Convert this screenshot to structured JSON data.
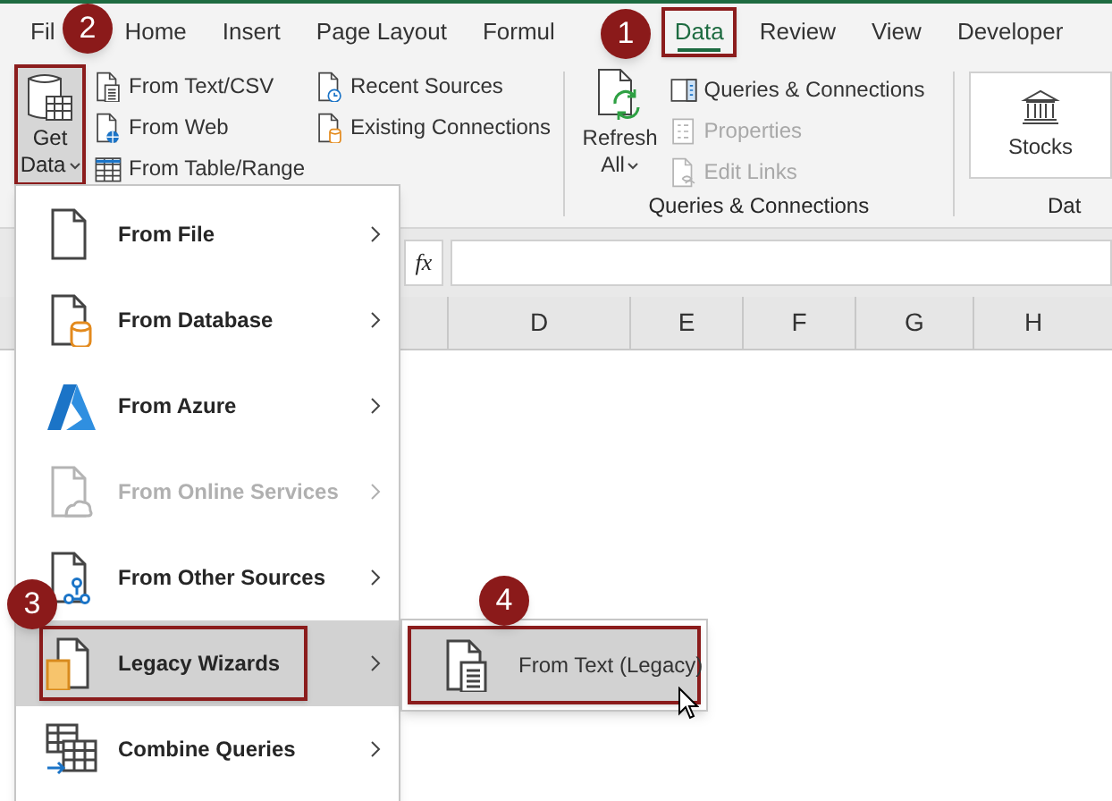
{
  "tabs": [
    {
      "label": "Fil",
      "selected": false,
      "highlighted": false
    },
    {
      "label": "Home",
      "selected": false,
      "highlighted": false
    },
    {
      "label": "Insert",
      "selected": false,
      "highlighted": false
    },
    {
      "label": "Page Layout",
      "selected": false,
      "highlighted": false
    },
    {
      "label": "Formul",
      "selected": false,
      "highlighted": false
    },
    {
      "label": "Data",
      "selected": true,
      "highlighted": true
    },
    {
      "label": "Review",
      "selected": false,
      "highlighted": false
    },
    {
      "label": "View",
      "selected": false,
      "highlighted": false
    },
    {
      "label": "Developer",
      "selected": false,
      "highlighted": false
    }
  ],
  "ribbon": {
    "get_data": {
      "lines": [
        "Get",
        "Data"
      ],
      "highlighted": true
    },
    "get_transform_buttons": [
      {
        "label": "From Text/CSV"
      },
      {
        "label": "From Web"
      },
      {
        "label": "From Table/Range"
      },
      {
        "label": "Recent Sources"
      },
      {
        "label": "Existing Connections"
      }
    ],
    "refresh_all": {
      "lines": [
        "Refresh",
        "All"
      ]
    },
    "queries_buttons": [
      {
        "label": "Queries & Connections",
        "disabled": false
      },
      {
        "label": "Properties",
        "disabled": true
      },
      {
        "label": "Edit Links",
        "disabled": true
      }
    ],
    "queries_group_label": "Queries & Connections",
    "stocks": {
      "label": "Stocks"
    },
    "data_types_group_label": "Dat"
  },
  "formula_bar": {
    "fx": "fx"
  },
  "columns": [
    "D",
    "E",
    "F",
    "G",
    "H"
  ],
  "get_data_menu": [
    {
      "label": "From File",
      "disabled": false,
      "selected": false,
      "highlighted": false
    },
    {
      "label": "From Database",
      "disabled": false,
      "selected": false,
      "highlighted": false
    },
    {
      "label": "From Azure",
      "disabled": false,
      "selected": false,
      "highlighted": false
    },
    {
      "label": "From Online Services",
      "disabled": true,
      "selected": false,
      "highlighted": false
    },
    {
      "label": "From Other Sources",
      "disabled": false,
      "selected": false,
      "highlighted": false
    },
    {
      "label": "Legacy Wizards",
      "disabled": false,
      "selected": true,
      "highlighted": true
    },
    {
      "label": "Combine Queries",
      "disabled": false,
      "selected": false,
      "highlighted": false
    }
  ],
  "submenu": [
    {
      "label": "From Text (Legacy)",
      "selected": true,
      "highlighted": true
    }
  ],
  "annotations": [
    {
      "number": "1"
    },
    {
      "number": "2"
    },
    {
      "number": "3"
    },
    {
      "number": "4"
    }
  ]
}
